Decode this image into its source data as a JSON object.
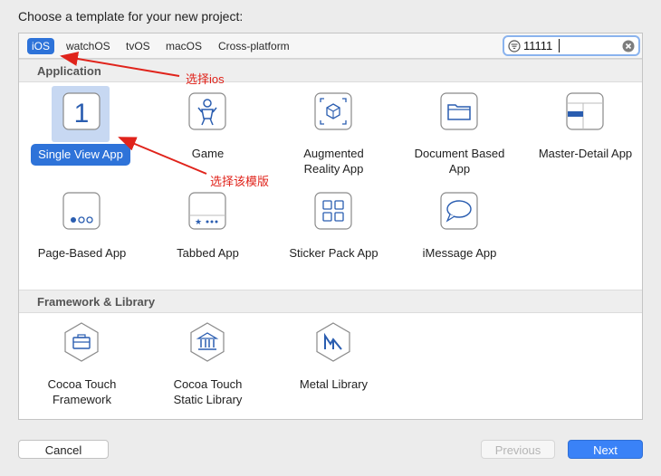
{
  "dialog": {
    "heading": "Choose a template for your new project:"
  },
  "tabs": [
    {
      "label": "iOS",
      "active": true
    },
    {
      "label": "watchOS",
      "active": false
    },
    {
      "label": "tvOS",
      "active": false
    },
    {
      "label": "macOS",
      "active": false
    },
    {
      "label": "Cross-platform",
      "active": false
    }
  ],
  "search": {
    "value": "11111",
    "icon": "filter-icon",
    "clear_icon": "clear-icon"
  },
  "sections": [
    {
      "title": "Application",
      "items": [
        {
          "label": "Single View App",
          "icon": "single-view-app-icon",
          "selected": true
        },
        {
          "label": "Game",
          "icon": "game-icon"
        },
        {
          "label": "Augmented\nReality App",
          "icon": "augmented-reality-icon"
        },
        {
          "label": "Document Based\nApp",
          "icon": "document-based-app-icon"
        },
        {
          "label": "Master-Detail App",
          "icon": "master-detail-app-icon"
        },
        {
          "label": "Page-Based App",
          "icon": "page-based-app-icon"
        },
        {
          "label": "Tabbed App",
          "icon": "tabbed-app-icon"
        },
        {
          "label": "Sticker Pack App",
          "icon": "sticker-pack-icon"
        },
        {
          "label": "iMessage App",
          "icon": "imessage-app-icon"
        }
      ]
    },
    {
      "title": "Framework & Library",
      "items": [
        {
          "label": "Cocoa Touch\nFramework",
          "icon": "framework-icon"
        },
        {
          "label": "Cocoa Touch\nStatic Library",
          "icon": "static-library-icon"
        },
        {
          "label": "Metal Library",
          "icon": "metal-library-icon"
        }
      ]
    }
  ],
  "buttons": {
    "cancel": "Cancel",
    "previous": "Previous",
    "next": "Next"
  },
  "annotations": {
    "ios": "选择ios",
    "template": "选择该模版"
  },
  "colors": {
    "accent": "#2e73d9",
    "annotation": "#e0231b"
  }
}
